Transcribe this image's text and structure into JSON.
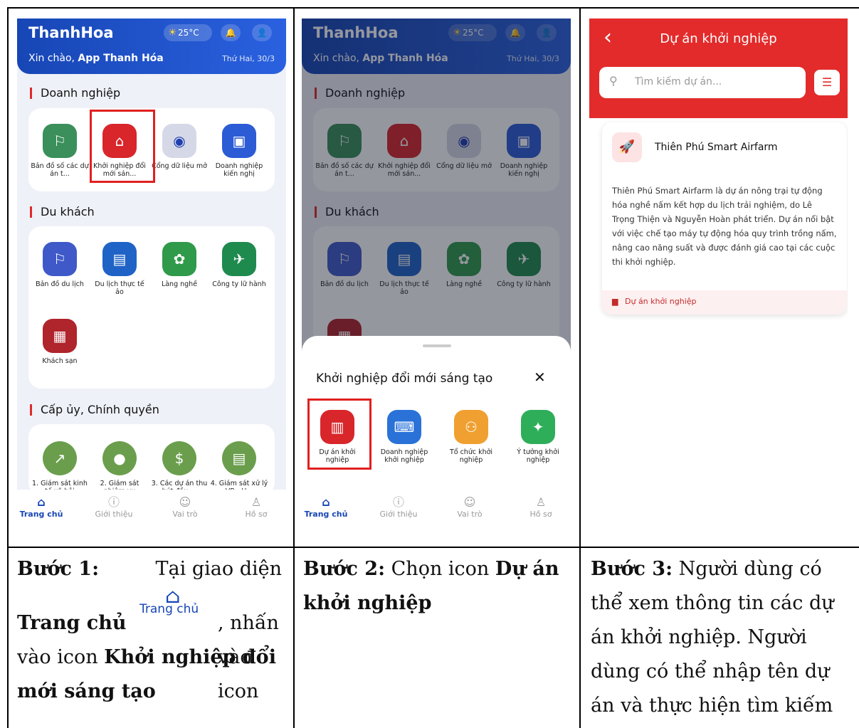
{
  "common": {
    "brand": "ThanhHoa",
    "temp": "25°C",
    "greeting_prefix": "Xin chào, ",
    "greeting_name": "App Thanh Hóa",
    "date": "Thứ Hai, 30/3",
    "section_business": "Doanh nghiệp",
    "section_tourist": "Du khách",
    "section_gov": "Cấp ủy, Chính quyền",
    "business_tiles": [
      {
        "label": "Bản đồ số các dự án t...",
        "icon": "map-icon",
        "color": "#3a8f5a"
      },
      {
        "label": "Khởi nghiệp đổi mới sán...",
        "icon": "startup-icon",
        "color": "#d8262b"
      },
      {
        "label": "Cổng dữ liệu mở",
        "icon": "open-data-icon",
        "color": "#d5d8e6"
      },
      {
        "label": "Doanh nghiệp kiến nghị",
        "icon": "briefcase-icon",
        "color": "#2c5bd6"
      }
    ],
    "tourist_tiles": [
      {
        "label": "Bản đồ du lịch",
        "icon": "travel-map-icon",
        "color": "#3f59c9"
      },
      {
        "label": "Du lịch thực tế ảo",
        "icon": "luggage-icon",
        "color": "#1f63c6"
      },
      {
        "label": "Làng nghề",
        "icon": "craft-village-icon",
        "color": "#2f9a4a"
      },
      {
        "label": "Công ty lữ hành",
        "icon": "tour-company-icon",
        "color": "#1f8a4e"
      }
    ],
    "hotel_tile": {
      "label": "Khách sạn",
      "icon": "hotel-icon",
      "color": "#b0242b"
    },
    "gov_tiles": [
      {
        "label": "1. Giám sát kinh tế xã hội",
        "icon": "chart-growth-icon"
      },
      {
        "label": "2. Giám sát nhiệm vụ",
        "icon": "coin-task-icon"
      },
      {
        "label": "3. Các dự án thu hút đầu ...",
        "icon": "investment-icon"
      },
      {
        "label": "4. Giám sát xử lý VB - H...",
        "icon": "document-icon"
      }
    ],
    "tabs": [
      {
        "label": "Trang chủ",
        "icon": "home-icon",
        "glyph": "⌂"
      },
      {
        "label": "Giới thiệu",
        "icon": "info-icon",
        "glyph": "ⓘ"
      },
      {
        "label": "Vai trò",
        "icon": "role-icon",
        "glyph": "☺"
      },
      {
        "label": "Hồ sơ",
        "icon": "profile-icon",
        "glyph": "♙"
      }
    ]
  },
  "step2_sheet": {
    "title": "Khởi nghiệp đổi mới sáng tạo",
    "close": "✕",
    "items": [
      {
        "label": "Dự án khởi nghiệp",
        "icon": "project-icon",
        "color": "#d8262b"
      },
      {
        "label": "Doanh nghiệp khởi nghiệp",
        "icon": "rocket-laptop-icon",
        "color": "#2a72d8"
      },
      {
        "label": "Tổ chức khởi nghiệp",
        "icon": "organization-icon",
        "color": "#f0a030"
      },
      {
        "label": "Ý tưởng khởi nghiệp",
        "icon": "idea-icon",
        "color": "#2fae5a"
      }
    ]
  },
  "step3": {
    "title": "Dự án khởi nghiệp",
    "back": "‹",
    "search_placeholder": "Tìm kiếm dự án...",
    "project_name": "Thiên Phú Smart Airfarm",
    "project_desc": "Thiên Phú Smart Airfarm là dự án nông trại tự động hóa nghề nấm kết hợp du lịch trải nghiệm, do Lê Trọng Thiện và Nguyễn Hoàn phát triển. Dự án nổi bật với việc chế tạo máy tự động hóa quy trình trồng nấm, nâng cao năng suất và được đánh giá cao tại các cuộc thi khởi nghiệp.",
    "project_tag": "Dự án khởi nghiệp"
  },
  "captions": {
    "step1_label": "Bước 1:",
    "step1_text_a": " Tại giao diện",
    "step1_bold_a": "Trang chủ",
    "step1_inline_icon_label": "Trang chủ",
    "step1_text_b": ", nhấn vào icon ",
    "step1_bold_b": "Khởi nghiệp đổi mới sáng tạo",
    "step2_label": "Bước 2:",
    "step2_text": " Chọn icon ",
    "step2_bold": "Dự án khởi nghiệp",
    "step3_label": "Bước 3:",
    "step3_text": " Người dùng có thể xem thông tin các dự án khởi nghiệp. Người dùng có thể nhập tên dự án và thực hiện tìm kiếm"
  },
  "colors": {
    "red": "#e02a2a",
    "blue": "#1746b5",
    "redbox": "#e0201f"
  }
}
